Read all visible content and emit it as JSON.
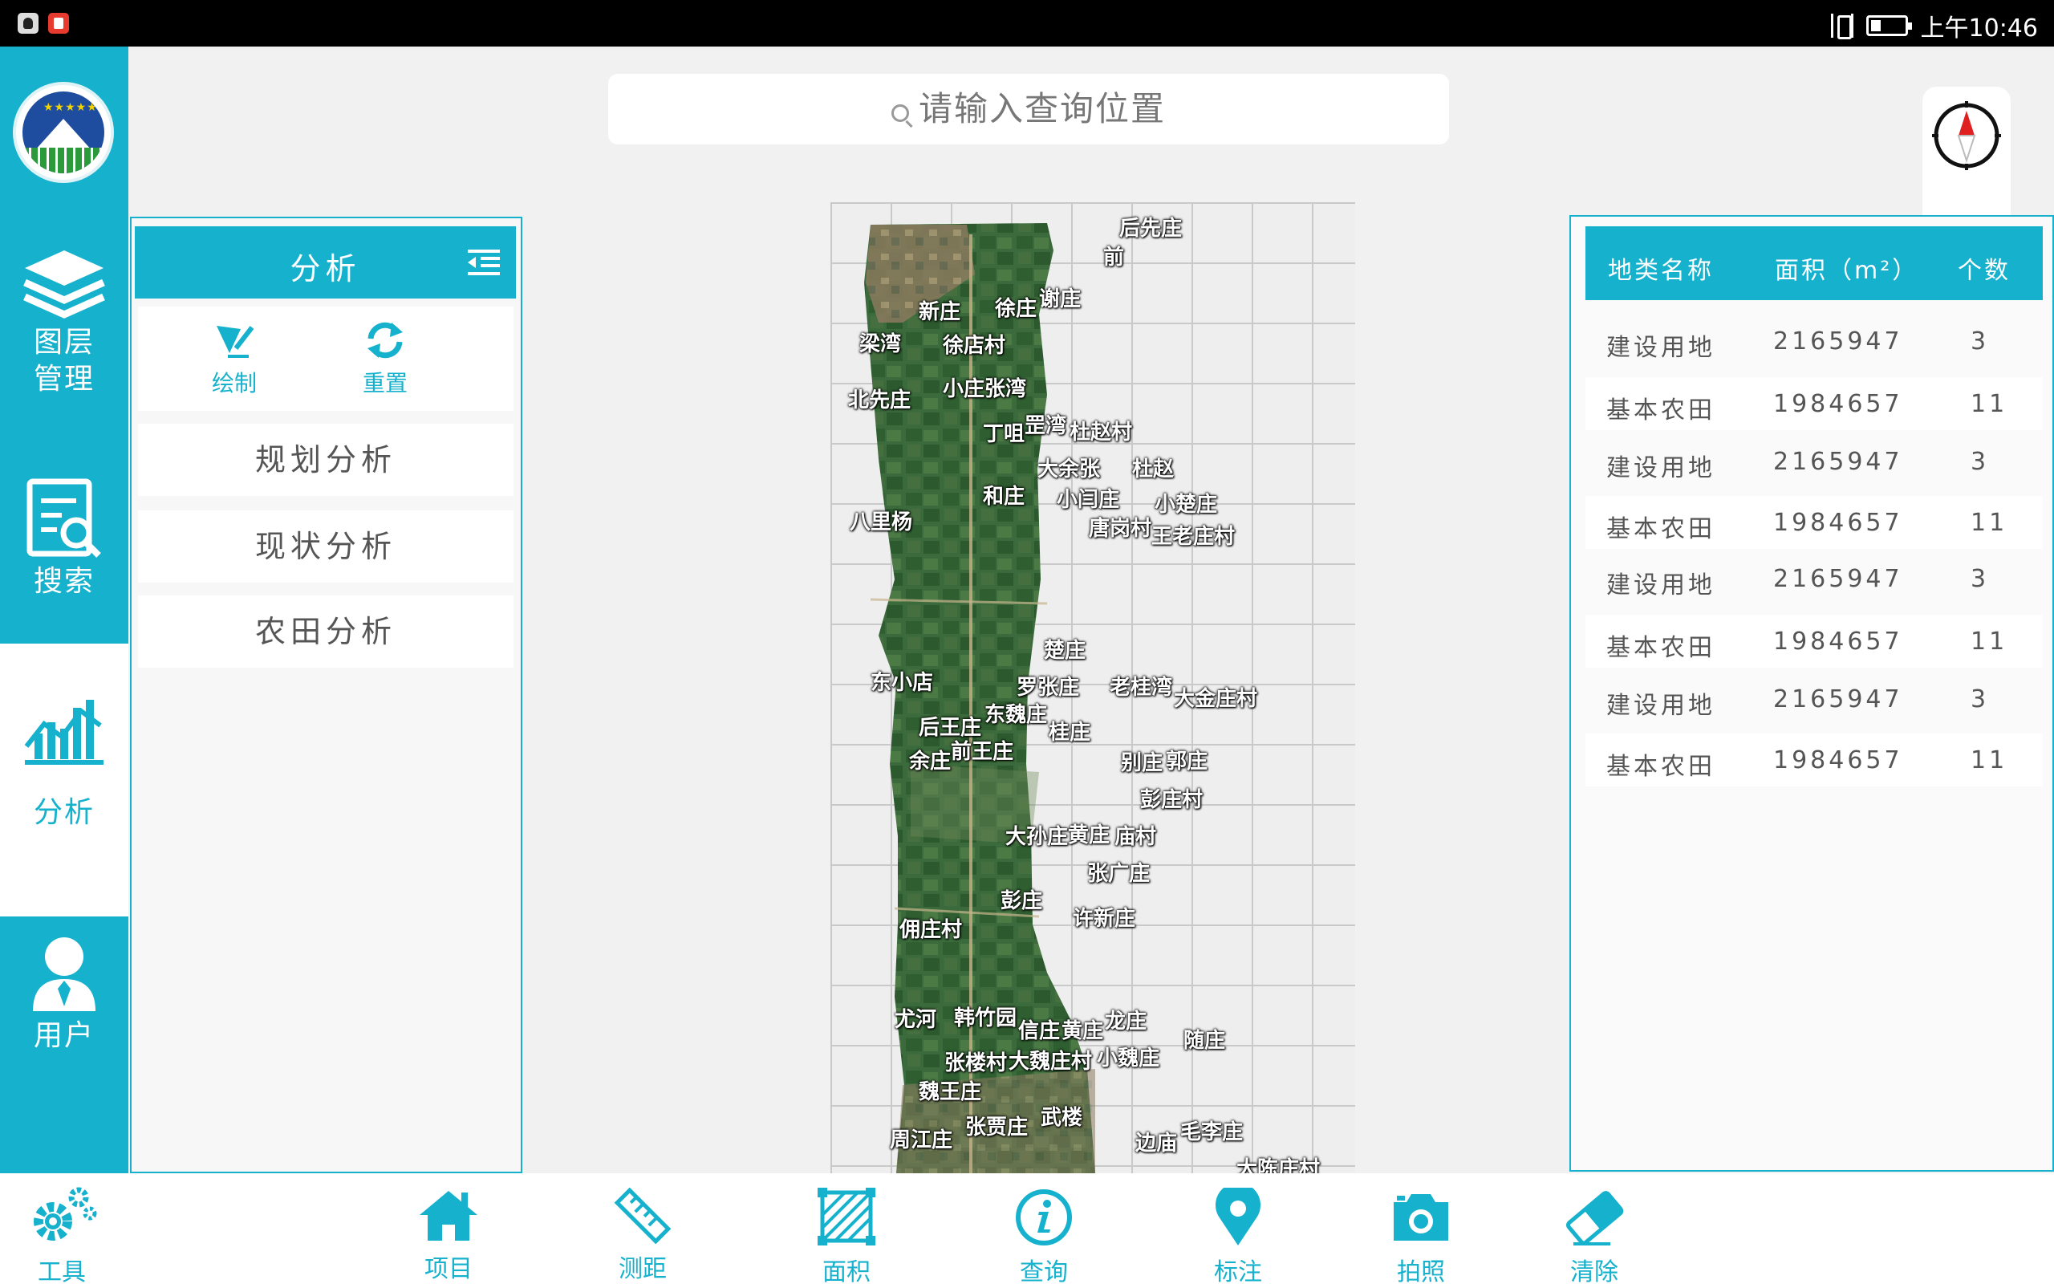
{
  "status_bar": {
    "time": "上午10:46"
  },
  "left_nav": {
    "items": [
      {
        "label_line1": "图层",
        "label_line2": "管理",
        "icon": "layers-icon"
      },
      {
        "label": "搜索",
        "icon": "search-doc-icon"
      },
      {
        "label": "分析",
        "icon": "analysis-chart-icon",
        "active": true
      },
      {
        "label": "用户",
        "icon": "user-icon"
      }
    ]
  },
  "panel": {
    "title": "分析",
    "tools": [
      {
        "label": "绘制",
        "icon": "draw-pen-icon"
      },
      {
        "label": "重置",
        "icon": "refresh-icon"
      }
    ],
    "menu": [
      "规划分析",
      "现状分析",
      "农田分析"
    ]
  },
  "search": {
    "placeholder": "请输入查询位置"
  },
  "map": {
    "villages": [
      "后先庄",
      "前",
      "新庄",
      "徐庄",
      "谢庄",
      "梁湾",
      "徐店村",
      "北先庄",
      "小庄张湾",
      "丁咀",
      "罡湾",
      "杜赵村",
      "大余张",
      "杜赵",
      "和庄",
      "小闫庄",
      "小楚庄",
      "八里杨",
      "唐岗村",
      "王老庄村",
      "楚庄",
      "东小店",
      "罗张庄",
      "老桂湾",
      "大金庄村",
      "后王庄",
      "东魏庄",
      "桂庄",
      "余庄",
      "前王庄",
      "别庄",
      "郭庄",
      "彭庄村",
      "大孙庄",
      "黄庄",
      "庙村",
      "张广庄",
      "彭庄",
      "许新庄",
      "佣庄村",
      "尤河",
      "韩竹园",
      "信庄",
      "黄庄",
      "龙庄",
      "随庄",
      "张楼村",
      "大魏庄村",
      "小魏庄",
      "魏王庄",
      "周江庄",
      "张贾庄",
      "武楼",
      "边庙",
      "毛李庄",
      "大陈庄村"
    ]
  },
  "table": {
    "headers": [
      "地类名称",
      "面积（m²）",
      "个数"
    ],
    "rows": [
      [
        "建设用地",
        "2165947",
        "3"
      ],
      [
        "基本农田",
        "1984657",
        "11"
      ],
      [
        "建设用地",
        "2165947",
        "3"
      ],
      [
        "基本农田",
        "1984657",
        "11"
      ],
      [
        "建设用地",
        "2165947",
        "3"
      ],
      [
        "基本农田",
        "1984657",
        "11"
      ],
      [
        "建设用地",
        "2165947",
        "3"
      ],
      [
        "基本农田",
        "1984657",
        "11"
      ]
    ]
  },
  "bottom_bar": {
    "tools_label": "工具",
    "items": [
      "项目",
      "测距",
      "面积",
      "查询",
      "标注",
      "拍照",
      "清除"
    ]
  },
  "colors": {
    "accent": "#15b1cd",
    "compass_red": "#e02020"
  }
}
